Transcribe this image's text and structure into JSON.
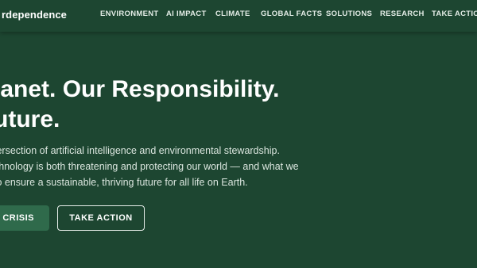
{
  "nav": {
    "logo": "rdependence",
    "links": [
      {
        "label": "ENVIRONMENT"
      },
      {
        "label": "AI IMPACT"
      },
      {
        "label": "CLIMATE"
      },
      {
        "label": "GLOBAL FACTS"
      },
      {
        "label": "SOLUTIONS"
      },
      {
        "label": "RESEARCH"
      },
      {
        "label": "TAKE ACTION"
      }
    ]
  },
  "hero": {
    "title_line1": "lanet. Our Responsibility.",
    "title_line2": "uture.",
    "desc_line1": "tersection of artificial intelligence and environmental stewardship.",
    "desc_line2": "chnology is both threatening and protecting our world — and what we",
    "desc_line3": "to ensure a sustainable, thriving future for all life on Earth.",
    "primary_button": "E CRISIS",
    "secondary_button": "TAKE ACTION"
  },
  "colors": {
    "background": "#1d4631",
    "primary_button": "#2f6a4b",
    "text": "#ffffff"
  }
}
